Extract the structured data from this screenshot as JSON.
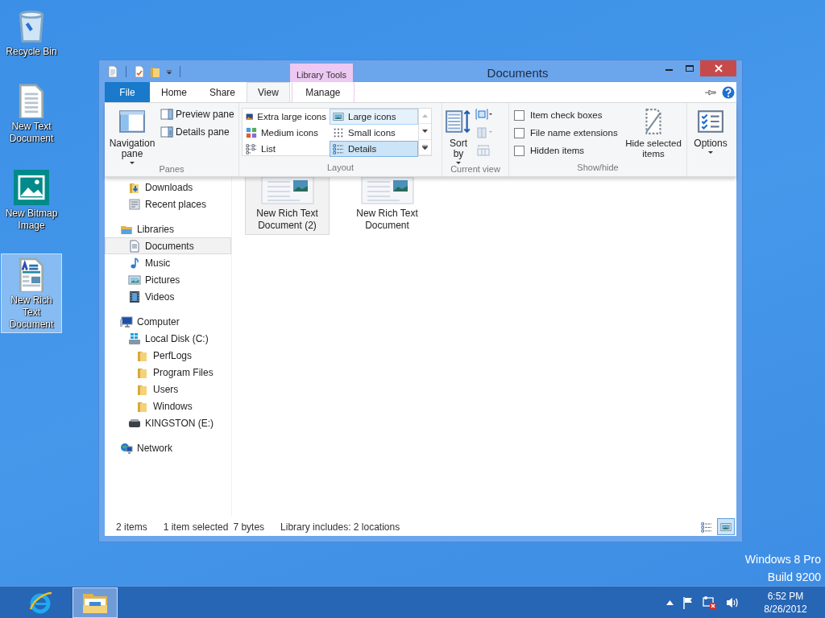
{
  "desktop_icons": [
    {
      "label": "Recycle Bin",
      "kind": "recycle",
      "selected": false
    },
    {
      "label": "New Text Document",
      "kind": "text",
      "selected": false
    },
    {
      "label": "New Bitmap Image",
      "kind": "bitmap",
      "selected": false
    },
    {
      "label": "New Rich Text Document",
      "kind": "rich",
      "selected": true
    }
  ],
  "window": {
    "title": "Documents",
    "contextual_group": "Library Tools"
  },
  "ribbon_tabs": [
    {
      "label": "File",
      "kind": "file",
      "selected": false
    },
    {
      "label": "Home",
      "kind": "plain",
      "selected": false
    },
    {
      "label": "Share",
      "kind": "plain",
      "selected": false
    },
    {
      "label": "View",
      "kind": "plain",
      "selected": true
    },
    {
      "label": "Manage",
      "kind": "contextual",
      "selected": false
    }
  ],
  "ribbon": {
    "panes": {
      "label": "Panes",
      "navigation_pane": "Navigation pane",
      "preview_pane": "Preview pane",
      "details_pane": "Details pane"
    },
    "layout": {
      "label": "Layout",
      "options": [
        {
          "label": "Extra large icons",
          "kind": "xl",
          "selected": false,
          "hovered": false
        },
        {
          "label": "Large icons",
          "kind": "large",
          "selected": true,
          "hovered": false
        },
        {
          "label": "Medium icons",
          "kind": "medium",
          "selected": false,
          "hovered": false
        },
        {
          "label": "Small icons",
          "kind": "small",
          "selected": false,
          "hovered": false
        },
        {
          "label": "List",
          "kind": "list",
          "selected": false,
          "hovered": false
        },
        {
          "label": "Details",
          "kind": "details",
          "selected": false,
          "hovered": true
        }
      ]
    },
    "current_view": {
      "label": "Current view",
      "sort_by": "Sort by"
    },
    "show_hide": {
      "label": "Show/hide",
      "checkboxes": [
        {
          "label": "Item check boxes",
          "checked": false
        },
        {
          "label": "File name extensions",
          "checked": false
        },
        {
          "label": "Hidden items",
          "checked": false
        }
      ],
      "hide_selected": "Hide selected items"
    },
    "options": "Options"
  },
  "navigation": [
    {
      "items": [
        {
          "label": "Downloads",
          "kind": "downloads",
          "selected": false
        },
        {
          "label": "Recent places",
          "kind": "recent",
          "selected": false
        }
      ]
    },
    {
      "label": "Libraries",
      "kind": "libraries",
      "selected": false,
      "children": [
        {
          "label": "Documents",
          "kind": "documents",
          "selected": true
        },
        {
          "label": "Music",
          "kind": "music",
          "selected": false
        },
        {
          "label": "Pictures",
          "kind": "pictures",
          "selected": false
        },
        {
          "label": "Videos",
          "kind": "videos",
          "selected": false
        }
      ]
    },
    {
      "label": "Computer",
      "kind": "computer",
      "selected": false,
      "children": [
        {
          "label": "Local Disk (C:)",
          "kind": "disk",
          "selected": false,
          "children": [
            {
              "label": "PerfLogs",
              "kind": "folder",
              "selected": false
            },
            {
              "label": "Program Files",
              "kind": "folder",
              "selected": false
            },
            {
              "label": "Users",
              "kind": "folder",
              "selected": false
            },
            {
              "label": "Windows",
              "kind": "folder",
              "selected": false
            }
          ]
        },
        {
          "label": "KINGSTON (E:)",
          "kind": "drive",
          "selected": false
        }
      ]
    },
    {
      "label": "Network",
      "kind": "network",
      "selected": false
    }
  ],
  "files": [
    {
      "name": "New Rich Text Document (2)",
      "selected": true
    },
    {
      "name": "New Rich Text Document",
      "selected": false
    }
  ],
  "status_bar": {
    "item_count": "2 items",
    "selection": "1 item selected",
    "size": "7 bytes",
    "library_info": "Library includes: 2 locations",
    "view_buttons": [
      {
        "kind": "details",
        "selected": false
      },
      {
        "kind": "large",
        "selected": true
      }
    ]
  },
  "os_edition": [
    "Windows 8 Pro",
    "Build 9200"
  ],
  "taskbar": {
    "apps": [
      {
        "kind": "browser",
        "selected": false
      },
      {
        "kind": "explorer",
        "selected": true
      }
    ],
    "time": "6:52 PM",
    "date": "8/26/2012"
  }
}
